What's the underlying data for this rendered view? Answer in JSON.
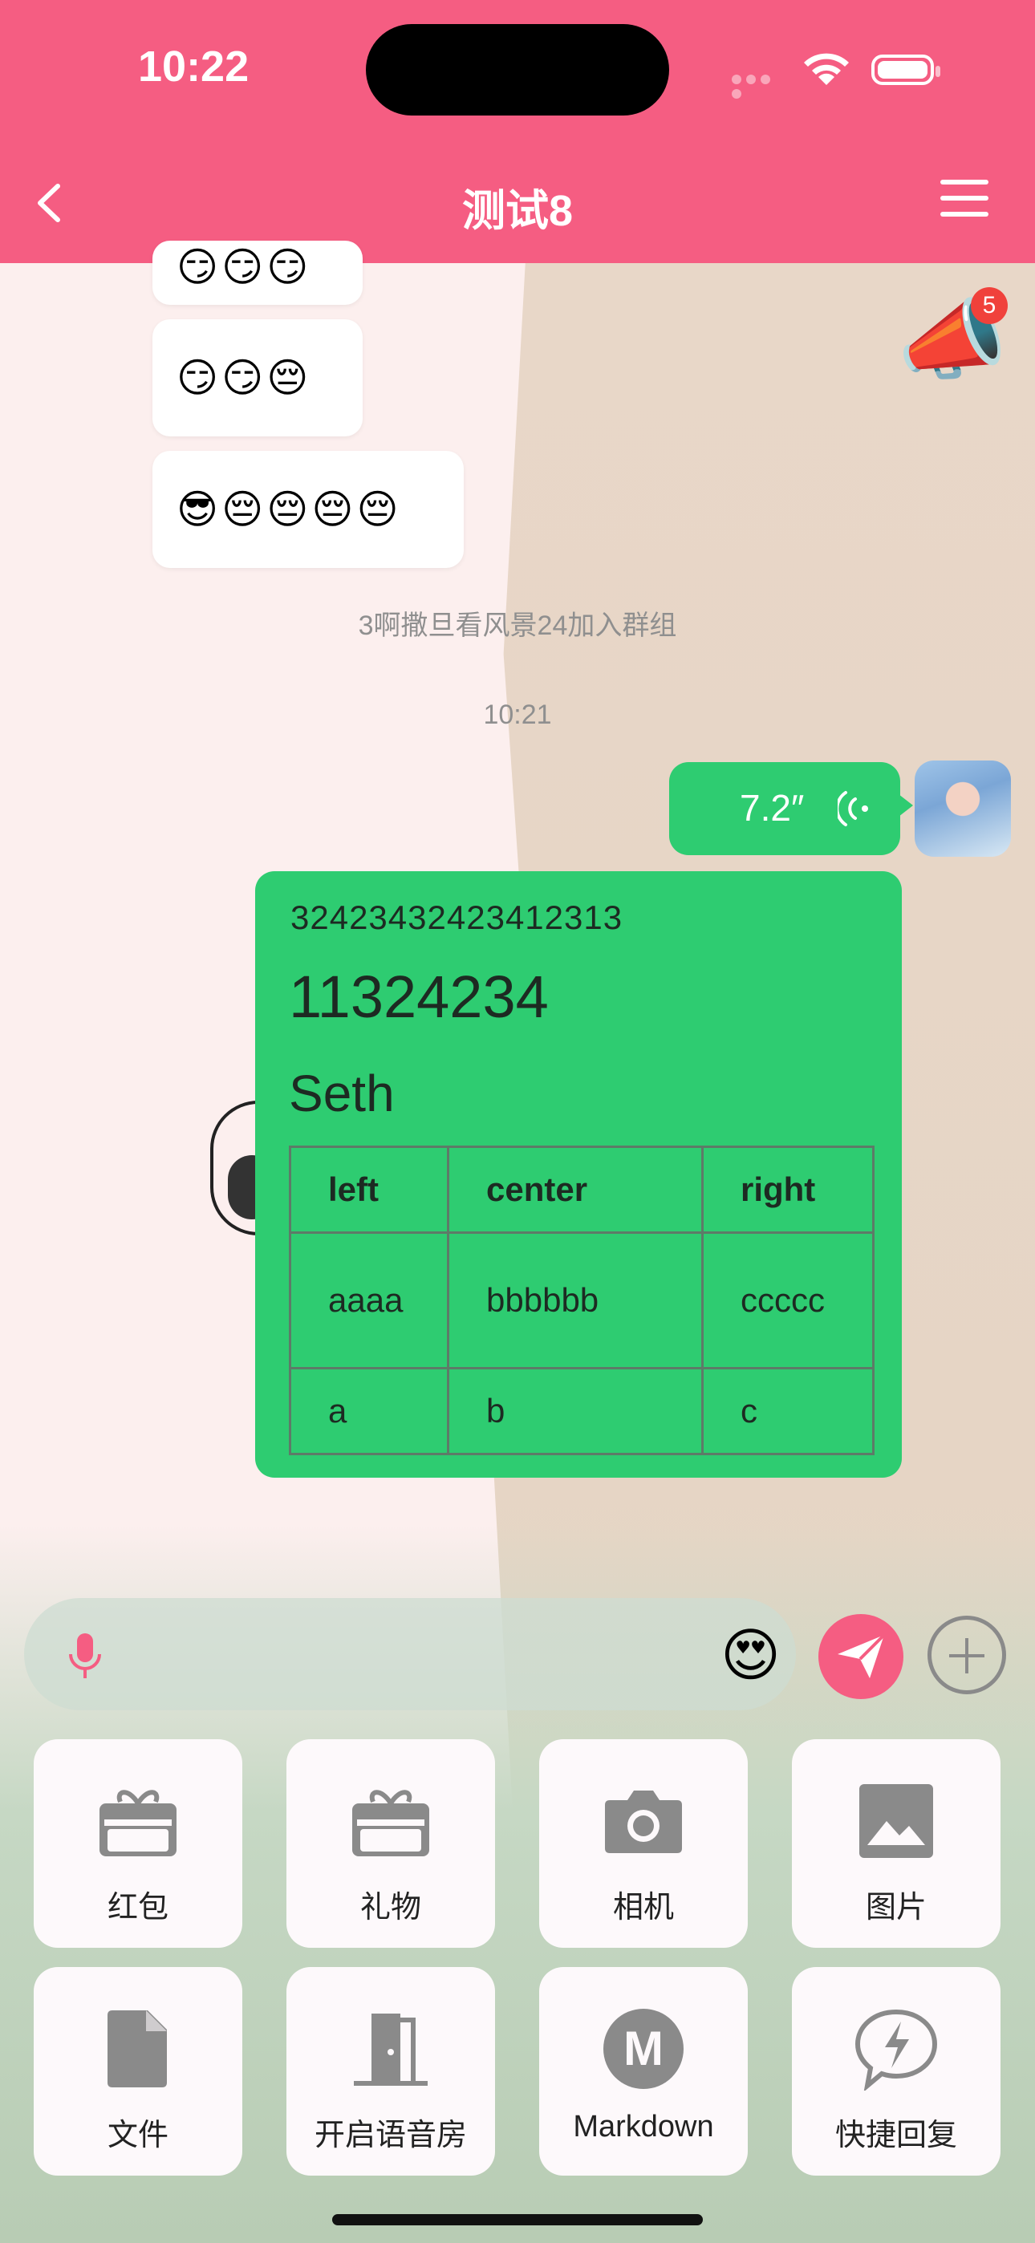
{
  "status_bar": {
    "time": "10:22"
  },
  "nav": {
    "title": "测试8"
  },
  "messages": {
    "emoji_row_top": "😏😏😏",
    "emoji_row_2": "😏😏😔",
    "emoji_row_3": "😎😔😔😔😔",
    "system_join": "3啊撒旦看风景24加入群组",
    "timestamp": "10:21",
    "voice_duration": "7.2″",
    "notice_badge": "5"
  },
  "markdown": {
    "line1": "32423432423412313",
    "h1": "11324234",
    "h2": "Seth",
    "table": {
      "headers": [
        "left",
        "center",
        "right"
      ],
      "rows": [
        [
          "aaaa",
          "bbbbbb",
          "ccccc"
        ],
        [
          "a",
          "b",
          "c"
        ]
      ]
    }
  },
  "input": {
    "emoji": "😍"
  },
  "actions": [
    {
      "label": "红包",
      "icon": "red-packet-icon"
    },
    {
      "label": "礼物",
      "icon": "gift-icon"
    },
    {
      "label": "相机",
      "icon": "camera-icon"
    },
    {
      "label": "图片",
      "icon": "image-icon"
    },
    {
      "label": "文件",
      "icon": "file-icon"
    },
    {
      "label": "开启语音房",
      "icon": "door-icon"
    },
    {
      "label": "Markdown",
      "icon": "markdown-icon"
    },
    {
      "label": "快捷回复",
      "icon": "quick-reply-icon"
    }
  ],
  "colors": {
    "brand": "#f55d82",
    "bubble_green": "#2ecc71"
  }
}
